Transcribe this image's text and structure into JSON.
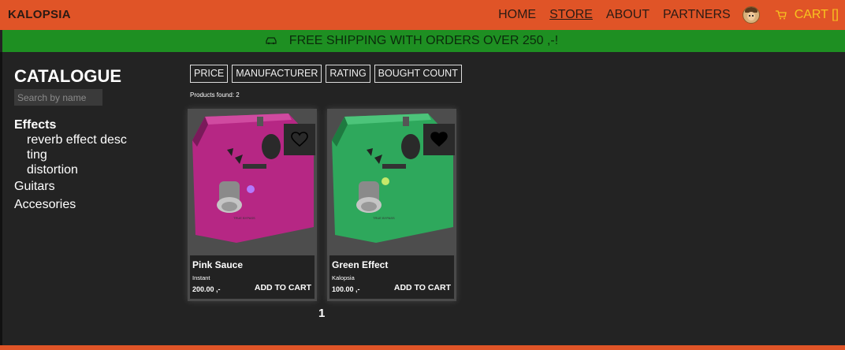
{
  "header": {
    "brand": "KALOPSIA",
    "nav": [
      "HOME",
      "STORE",
      "ABOUT",
      "PARTNERS"
    ],
    "cart_label": "CART []",
    "cart_color": "#f7c41f",
    "bar_color": "#e05427"
  },
  "banner": {
    "text": "FREE SHIPPING WITH ORDERS OVER 250 ,-!",
    "icon": "car-icon",
    "color": "#1e8f22"
  },
  "sidebar": {
    "title": "CATALOGUE",
    "search_placeholder": "Search by name",
    "effects_label": "Effects",
    "subcategories": [
      "reverb effect desc",
      "ting",
      "distortion"
    ],
    "categories": [
      "Guitars",
      "Accesories"
    ]
  },
  "filters": [
    "PRICE",
    "MANUFACTURER",
    "RATING",
    "BOUGHT COUNT"
  ],
  "products_found": "Products found: 2",
  "products": [
    {
      "name": "Pink Sauce",
      "manufacturer": "Instant",
      "price": "200.00 ,-",
      "add_label": "ADD TO CART",
      "favorited": false,
      "color": "#c02a8c"
    },
    {
      "name": "Green Effect",
      "manufacturer": "Kalopsia",
      "price": "100.00 ,-",
      "add_label": "ADD TO CART",
      "favorited": true,
      "color": "#2fae5e"
    }
  ],
  "pagination": {
    "current_page": "1"
  }
}
